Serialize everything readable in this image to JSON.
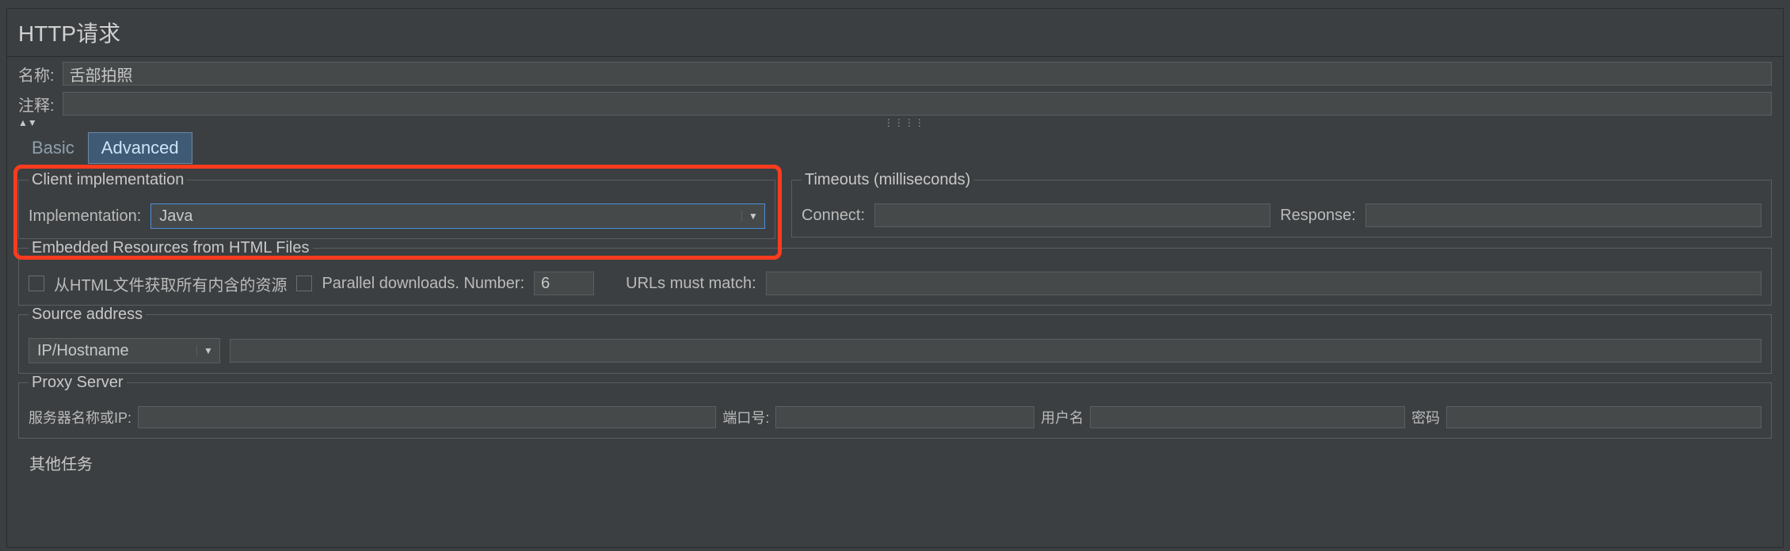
{
  "window": {
    "title": "HTTP请求"
  },
  "name": {
    "label": "名称:",
    "value": "舌部拍照"
  },
  "comment": {
    "label": "注释:"
  },
  "tabs": {
    "basic": "Basic",
    "advanced": "Advanced"
  },
  "client_impl": {
    "legend": "Client implementation",
    "label": "Implementation:",
    "value": "Java"
  },
  "timeouts": {
    "legend": "Timeouts (milliseconds)",
    "connect_label": "Connect:",
    "response_label": "Response:"
  },
  "embedded": {
    "legend": "Embedded Resources from HTML Files",
    "retrieve_label": "从HTML文件获取所有内含的资源",
    "parallel_label": "Parallel downloads. Number:",
    "parallel_value": "6",
    "urls_match_label": "URLs must match:"
  },
  "source_address": {
    "legend": "Source address",
    "select_value": "IP/Hostname"
  },
  "proxy": {
    "legend": "Proxy Server",
    "server_label": "服务器名称或IP:",
    "port_label": "端口号:",
    "user_label": "用户名",
    "pass_label": "密码"
  },
  "other": {
    "legend": "其他任务"
  }
}
